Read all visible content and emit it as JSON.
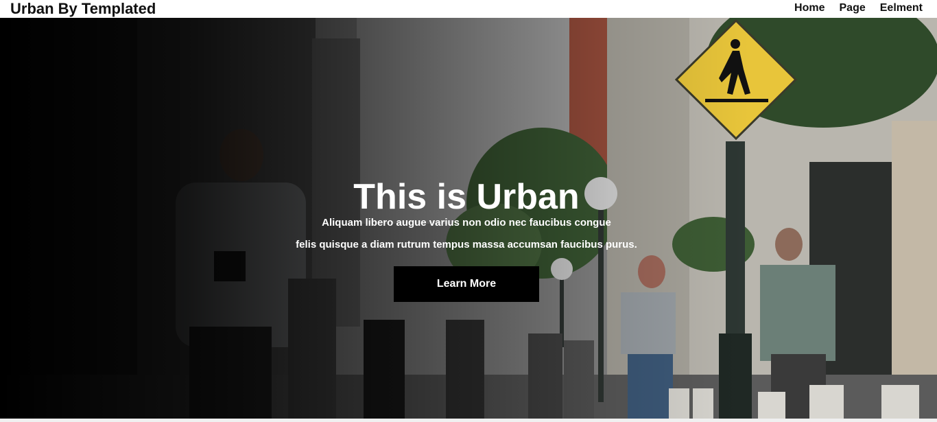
{
  "header": {
    "logo": "Urban By Templated",
    "nav": [
      {
        "label": "Home"
      },
      {
        "label": "Page"
      },
      {
        "label": "Eelment"
      }
    ]
  },
  "hero": {
    "title": "This is Urban",
    "text_line1": "Aliquam libero augue varius non odio nec faucibus congue",
    "text_line2": "felis quisque a diam rutrum tempus massa accumsan faucibus purus.",
    "cta_label": "Learn More",
    "background": "city-street-pedestrians-photo"
  },
  "colors": {
    "header_bg": "#ffffff",
    "text_dark": "#111111",
    "cta_bg": "#000000",
    "hero_text": "#ffffff",
    "sign_yellow": "#e8c53a"
  }
}
